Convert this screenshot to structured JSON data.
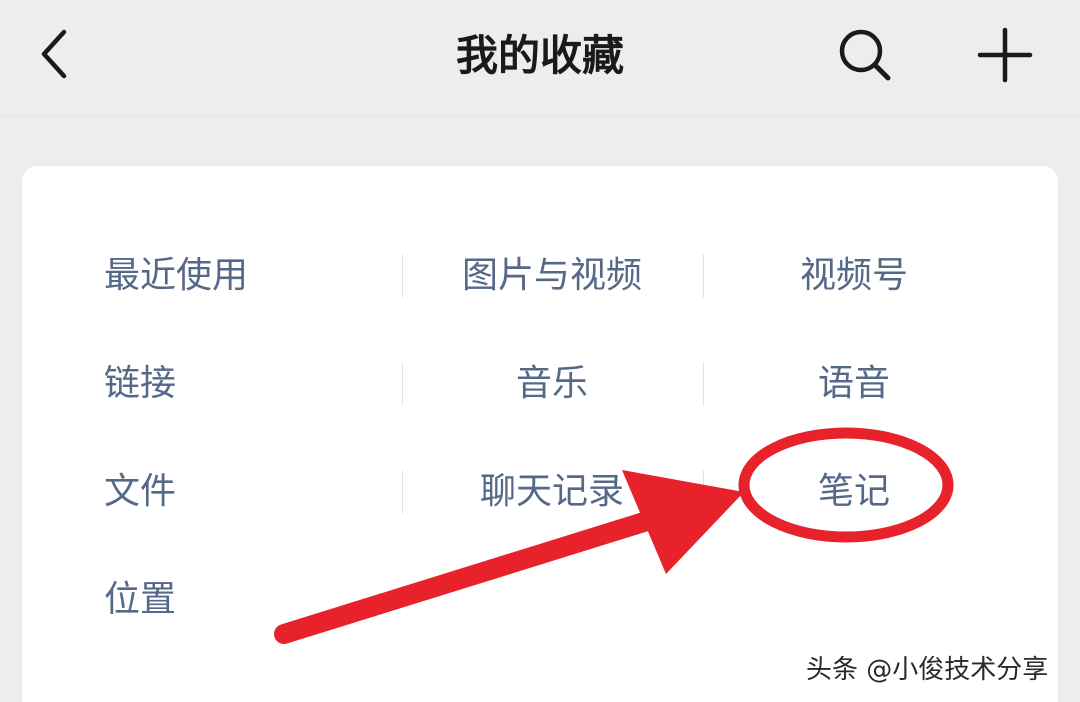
{
  "header": {
    "title": "我的收藏",
    "back_icon": "chevron-left-icon",
    "search_icon": "search-icon",
    "add_icon": "plus-icon"
  },
  "categories": {
    "row1": [
      "最近使用",
      "图片与视频",
      "视频号"
    ],
    "row2": [
      "链接",
      "音乐",
      "语音"
    ],
    "row3": [
      "文件",
      "聊天记录",
      "笔记"
    ],
    "row4": [
      "位置"
    ]
  },
  "annotation": {
    "highlight_color": "#e8222a",
    "highlighted_item": "笔记"
  },
  "watermark": "头条 @小俊技术分享",
  "colors": {
    "background": "#ededed",
    "card": "#ffffff",
    "item_text": "#566888",
    "title_text": "#1a1a1a"
  }
}
